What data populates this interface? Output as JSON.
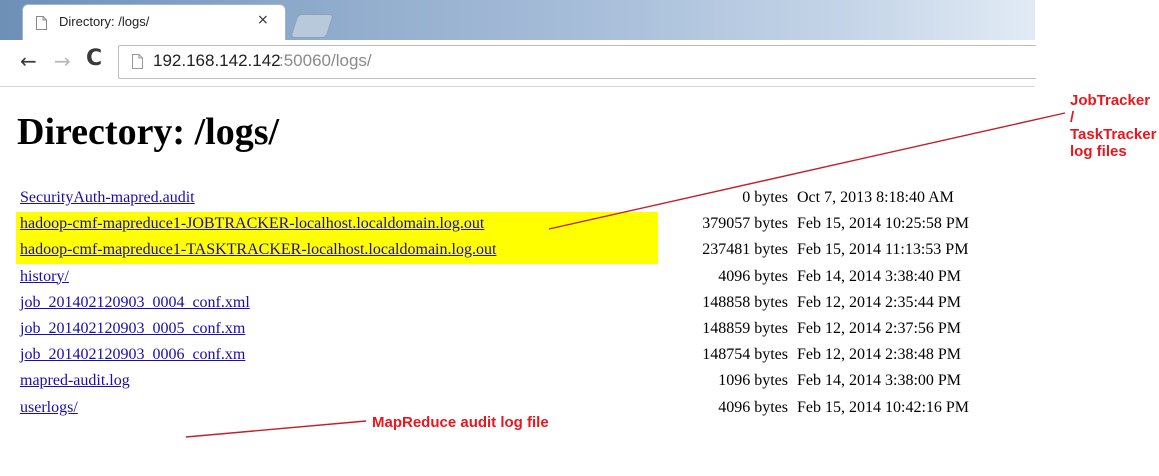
{
  "browser": {
    "tab": {
      "title": "Directory: /logs/",
      "close_glyph": "×",
      "favicon": "page-icon"
    },
    "new_tab_icon": "new-tab-icon",
    "toolbar": {
      "back_glyph": "←",
      "forward_glyph": "→",
      "reload_glyph": "C",
      "url_host": "192.168.142.142",
      "url_rest": ":50060/logs/"
    }
  },
  "page": {
    "title": "Directory: /logs/",
    "files": [
      {
        "name": "SecurityAuth-mapred.audit",
        "size": "0 bytes",
        "date": "Oct 7, 2013 8:18:40 AM",
        "highlighted": false
      },
      {
        "name": "hadoop-cmf-mapreduce1-JOBTRACKER-localhost.localdomain.log.out",
        "size": "379057 bytes",
        "date": "Feb 15, 2014 10:25:58 PM",
        "highlighted": true
      },
      {
        "name": "hadoop-cmf-mapreduce1-TASKTRACKER-localhost.localdomain.log.out",
        "size": "237481 bytes",
        "date": "Feb 15, 2014 11:13:53 PM",
        "highlighted": true
      },
      {
        "name": "history/",
        "size": "4096 bytes",
        "date": "Feb 14, 2014 3:38:40 PM",
        "highlighted": false
      },
      {
        "name": "job_201402120903_0004_conf.xml",
        "size": "148858 bytes",
        "date": "Feb 12, 2014 2:35:44 PM",
        "highlighted": false
      },
      {
        "name": "job_201402120903_0005_conf.xm",
        "size": "148859 bytes",
        "date": "Feb 12, 2014 2:37:56 PM",
        "highlighted": false
      },
      {
        "name": "job_201402120903_0006_conf.xm",
        "size": "148754 bytes",
        "date": "Feb 12, 2014 2:38:48 PM",
        "highlighted": false
      },
      {
        "name": "mapred-audit.log",
        "size": "1096 bytes",
        "date": "Feb 14, 2014 3:38:00 PM",
        "highlighted": false
      },
      {
        "name": "userlogs/",
        "size": "4096 bytes",
        "date": "Feb 15, 2014 10:42:16 PM",
        "highlighted": false
      }
    ]
  },
  "annotations": {
    "jobtracker_callout": "JobTracker / TaskTracker log files",
    "audit_callout": "MapReduce audit log file",
    "color": "#e8171f"
  },
  "colors": {
    "link": "#1a0dab",
    "highlight": "#ffff00"
  }
}
